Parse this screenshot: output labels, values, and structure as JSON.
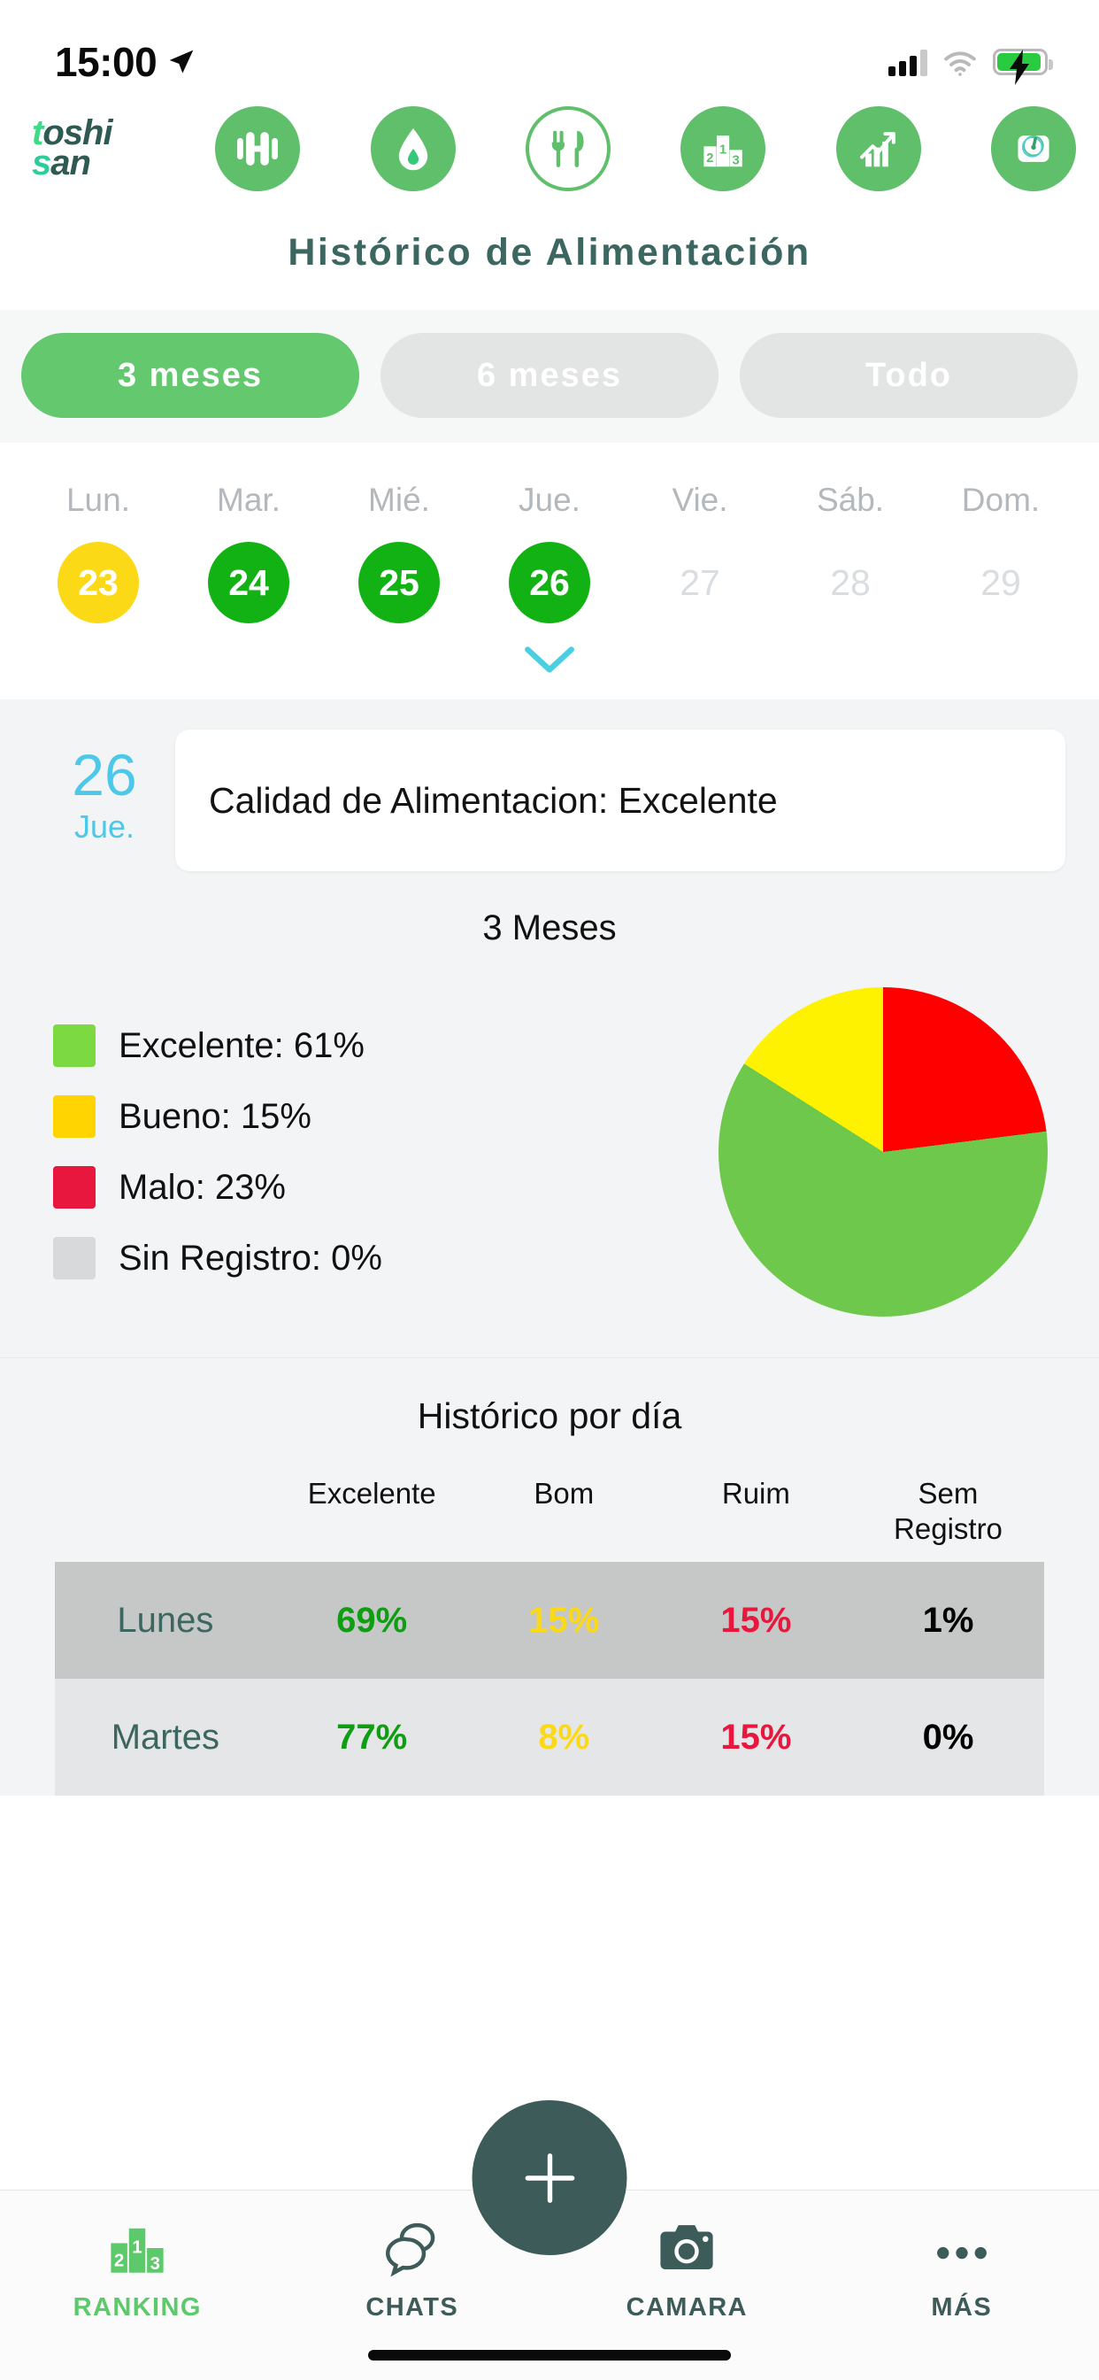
{
  "status_bar": {
    "time": "15:00",
    "location_icon": "location-arrow-icon",
    "signal_icon": "cellular-signal-icon",
    "wifi_icon": "wifi-icon",
    "battery_icon": "battery-charging-icon"
  },
  "header": {
    "logo_line1_a": "t",
    "logo_line1_b": "oshi",
    "logo_line2_a": "s",
    "logo_line2_b": "an",
    "nav_icons": [
      {
        "name": "dumbbell-icon",
        "label": "Ejercicio",
        "active": false
      },
      {
        "name": "water-drop-icon",
        "label": "Hidratación",
        "active": false
      },
      {
        "name": "cutlery-icon",
        "label": "Alimentación",
        "active": true
      },
      {
        "name": "podium-ranking-icon",
        "label": "Ranking",
        "active": false
      },
      {
        "name": "growth-chart-icon",
        "label": "Progreso",
        "active": false
      },
      {
        "name": "weight-scale-icon",
        "label": "Peso",
        "active": false
      }
    ]
  },
  "page": {
    "title": "Histórico de Alimentación"
  },
  "range_filter": {
    "options": [
      {
        "label": "3 meses",
        "active": true
      },
      {
        "label": "6 meses",
        "active": false
      },
      {
        "label": "Todo",
        "active": false
      }
    ]
  },
  "week": {
    "days": [
      {
        "dow": "Lun.",
        "num": "23",
        "state": "yellow"
      },
      {
        "dow": "Mar.",
        "num": "24",
        "state": "green"
      },
      {
        "dow": "Mié.",
        "num": "25",
        "state": "green"
      },
      {
        "dow": "Jue.",
        "num": "26",
        "state": "green"
      },
      {
        "dow": "Vie.",
        "num": "27",
        "state": "empty"
      },
      {
        "dow": "Sáb.",
        "num": "28",
        "state": "empty"
      },
      {
        "dow": "Dom.",
        "num": "29",
        "state": "empty"
      }
    ],
    "expand_icon": "chevron-down-icon"
  },
  "day_detail": {
    "day_number": "26",
    "day_of_week": "Jue.",
    "quality_text": "Calidad de Alimentacion: Excelente"
  },
  "colors": {
    "excelente": "#7DD941",
    "bueno": "#FFD400",
    "malo": "#E8173D",
    "sin_registro": "#D7D9DA",
    "pie_excelente": "#6DC84B",
    "pie_bueno": "#FFF200",
    "pie_malo": "#FF0000",
    "brand_green": "#5FBF6B",
    "brand_dark": "#3C5B59",
    "accent_blue": "#4EC8E8"
  },
  "chart_data": {
    "type": "pie",
    "title": "3 Meses",
    "categories": [
      "Excelente",
      "Bueno",
      "Malo",
      "Sin Registro"
    ],
    "values": [
      61,
      15,
      23,
      0
    ],
    "legend": [
      {
        "label": "Excelente: 61%",
        "swatch": "#7DD941"
      },
      {
        "label": "Bueno: 15%",
        "swatch": "#FFD400"
      },
      {
        "label": "Malo: 23%",
        "swatch": "#E8173D"
      },
      {
        "label": "Sin Registro: 0%",
        "swatch": "#D7D9DA"
      }
    ],
    "legend_position": "left",
    "start_angle_deg": 0,
    "direction": "clockwise",
    "slice_order": [
      "Malo",
      "Excelente",
      "Bueno"
    ],
    "slice_colors": [
      "#FF0000",
      "#6DC84B",
      "#FFF200"
    ]
  },
  "daily_table": {
    "title": "Histórico por día",
    "columns": [
      "",
      "Excelente",
      "Bom",
      "Ruim",
      "Sem Registro"
    ],
    "column_header_lines": [
      {
        "l1": "",
        "l2": ""
      },
      {
        "l1": "Excelente",
        "l2": ""
      },
      {
        "l1": "Bom",
        "l2": ""
      },
      {
        "l1": "Ruim",
        "l2": ""
      },
      {
        "l1": "Sem",
        "l2": "Registro"
      }
    ],
    "rows": [
      {
        "day": "Lunes",
        "excelente": "69%",
        "bom": "15%",
        "ruim": "15%",
        "sem": "1%"
      },
      {
        "day": "Martes",
        "excelente": "77%",
        "bom": "8%",
        "ruim": "15%",
        "sem": "0%"
      }
    ]
  },
  "bottom_nav": {
    "items": [
      {
        "label": "RANKING",
        "icon": "podium-ranking-icon",
        "active": true
      },
      {
        "label": "CHATS",
        "icon": "chat-bubbles-icon",
        "active": false
      },
      {
        "label": "CAMARA",
        "icon": "camera-icon",
        "active": false
      },
      {
        "label": "MÁS",
        "icon": "ellipsis-icon",
        "active": false
      }
    ],
    "fab_icon": "plus-icon"
  }
}
